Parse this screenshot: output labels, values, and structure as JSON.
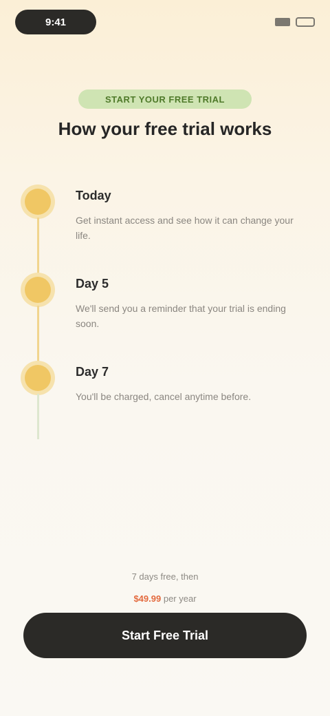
{
  "status_bar": {
    "time": "9:41"
  },
  "badge": {
    "label": "START YOUR FREE TRIAL"
  },
  "headline": "How your free trial works",
  "timeline": [
    {
      "title": "Today",
      "desc": "Get instant access and see how it can change your life."
    },
    {
      "title": "Day 5",
      "desc": "We'll send you a reminder that your trial is ending soon."
    },
    {
      "title": "Day 7",
      "desc": "You'll be charged, cancel anytime before."
    }
  ],
  "footer": {
    "prefix": "7 days free, then",
    "price": "$49.99",
    "suffix": "per year"
  },
  "cta": {
    "label": "Start Free Trial"
  }
}
